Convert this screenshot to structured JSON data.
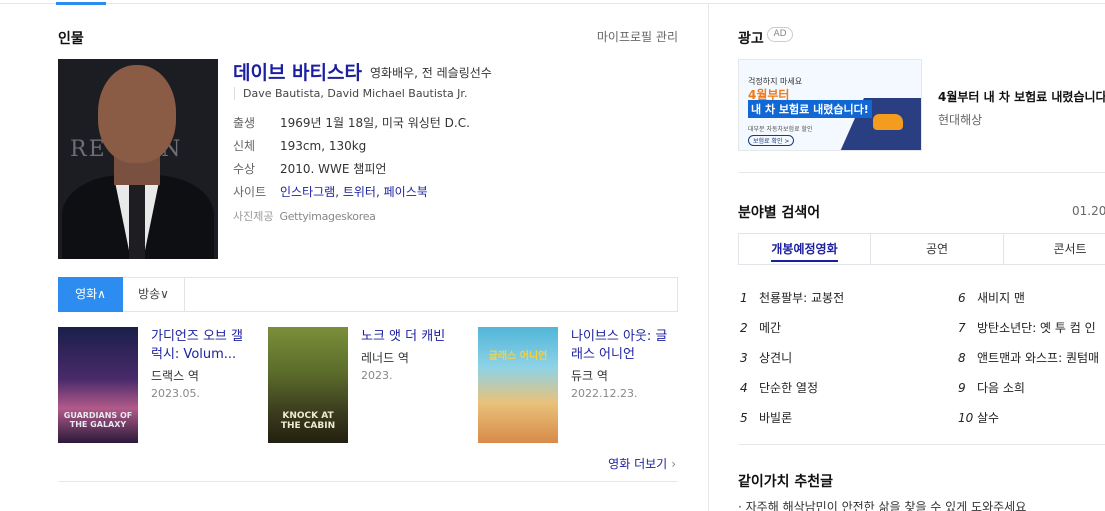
{
  "person": {
    "section_title": "인물",
    "manage_link": "마이프로필 관리",
    "name": "데이브 바티스타",
    "role": "영화배우, 전 레슬링선수",
    "english_name": "Dave Bautista, David Michael Bautista Jr.",
    "info": [
      {
        "key": "출생",
        "value": "1969년 1월 18일, 미국 워싱턴 D.C."
      },
      {
        "key": "신체",
        "value": "193cm, 130kg"
      },
      {
        "key": "수상",
        "value": "2010. WWE 챔피언"
      }
    ],
    "site_label": "사이트",
    "sites": [
      "인스타그램",
      "트위터",
      "페이스북"
    ],
    "photo_credit_label": "사진제공",
    "photo_credit": "Gettyimageskorea",
    "photo_bg_text": "RE   RTIN"
  },
  "filmo": {
    "tabs": [
      "영화∧",
      "방송∨"
    ],
    "movies": [
      {
        "title": "가디언즈 오브 갤럭시: Volum...",
        "role": "드랙스 역",
        "date": "2023.05.",
        "poster_text": "GUARDIANS OF THE GALAXY"
      },
      {
        "title": "노크 앳 더 캐빈",
        "role": "레너드 역",
        "date": "2023.",
        "poster_text": "KNOCK AT THE CABIN"
      },
      {
        "title": "나이브스 아웃: 글래스 어니언",
        "role": "듀크 역",
        "date": "2022.12.23.",
        "poster_text": "글래스 어니언"
      }
    ],
    "more_link": "영화 더보기",
    "more_chevron": "›"
  },
  "ad": {
    "title": "광고",
    "badge": "AD",
    "banner_line1": "걱정하지 마세요",
    "banner_line2": "4월부터",
    "banner_line3": "내 차 보험료 내렸습니다!",
    "banner_line4": "대부분 자동차보험료 할인",
    "banner_button": "보험료 확인 >",
    "text": "4월부터 내 차 보험료 내렸습니다",
    "advertiser": "현대해상"
  },
  "keywords": {
    "title": "분야별 검색어",
    "date": "01.20.",
    "tabs": [
      "개봉예정영화",
      "공연",
      "콘서트"
    ],
    "items": [
      {
        "rank": "1",
        "label": "천룡팔부: 교봉전"
      },
      {
        "rank": "2",
        "label": "메간"
      },
      {
        "rank": "3",
        "label": "상견니"
      },
      {
        "rank": "4",
        "label": "단순한 열정"
      },
      {
        "rank": "5",
        "label": "바빌론"
      },
      {
        "rank": "6",
        "label": "새비지 맨"
      },
      {
        "rank": "7",
        "label": "방탄소년단: 옛 투 컴 인"
      },
      {
        "rank": "8",
        "label": "앤트맨과 와스프: 퀀텀매"
      },
      {
        "rank": "9",
        "label": "다음 소희"
      },
      {
        "rank": "10",
        "label": "살수"
      }
    ]
  },
  "recommend": {
    "title": "같이가치 추천글",
    "text": "· 자주해 해삭남민이 안전한 삶을 찾을 수 있게 도와주세요"
  },
  "colors": {
    "accent": "#2d8cf0",
    "link": "#1c1fa0"
  }
}
